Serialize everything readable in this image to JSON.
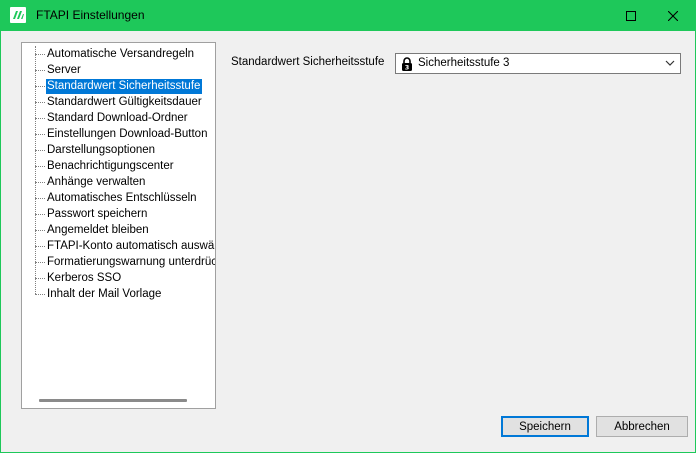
{
  "window": {
    "title": "FTAPI Einstellungen",
    "accent_color": "#1ec85a",
    "icons": [
      "app-logo-icon",
      "maximize-icon",
      "close-icon"
    ]
  },
  "tree": {
    "items": [
      {
        "label": "Automatische Versandregeln"
      },
      {
        "label": "Server"
      },
      {
        "label": "Standardwert Sicherheitsstufe",
        "selected": true
      },
      {
        "label": "Standardwert Gültigkeitsdauer"
      },
      {
        "label": "Standard Download-Ordner"
      },
      {
        "label": "Einstellungen Download-Button"
      },
      {
        "label": "Darstellungsoptionen"
      },
      {
        "label": "Benachrichtigungscenter"
      },
      {
        "label": "Anhänge verwalten"
      },
      {
        "label": "Automatisches Entschlüsseln"
      },
      {
        "label": "Passwort speichern"
      },
      {
        "label": "Angemeldet bleiben"
      },
      {
        "label": "FTAPI-Konto automatisch auswählen"
      },
      {
        "label": "Formatierungswarnung unterdrücken"
      },
      {
        "label": "Kerberos SSO"
      },
      {
        "label": "Inhalt der Mail Vorlage"
      }
    ],
    "selection_color": "#0078d7"
  },
  "settings": {
    "security_level_label": "Standardwert Sicherheitsstufe",
    "security_level_value": "Sicherheitsstufe 3",
    "security_level_icon": "lock-icon"
  },
  "buttons": {
    "save": "Speichern",
    "cancel": "Abbrechen"
  }
}
